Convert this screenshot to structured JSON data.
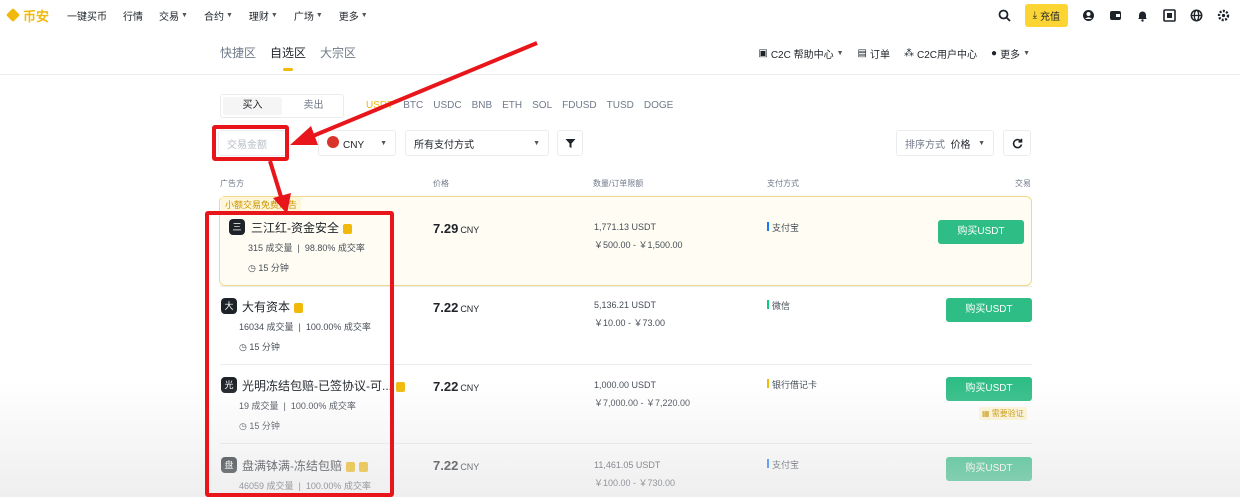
{
  "topbar": {
    "logo": "币安",
    "nav": [
      "一键买币",
      "行情",
      "交易",
      "合约",
      "理财",
      "广场",
      "更多"
    ],
    "nav_has_caret": [
      false,
      false,
      true,
      true,
      true,
      true,
      true
    ],
    "deposit": "充值"
  },
  "subnav": {
    "tabs": [
      "快捷区",
      "自选区",
      "大宗区"
    ],
    "active": "自选区"
  },
  "subnav_right": [
    "C2C 帮助中心",
    "订单",
    "C2C用户中心",
    "更多"
  ],
  "trade_toggle": {
    "buy": "买入",
    "sell": "卖出"
  },
  "coins": [
    "USDT",
    "BTC",
    "USDC",
    "BNB",
    "ETH",
    "SOL",
    "FDUSD",
    "TUSD",
    "DOGE"
  ],
  "coins_selected": "USDT",
  "filters": {
    "amount_placeholder": "交易金额",
    "currency": "CNY",
    "payment": "所有支付方式",
    "sort_label": "排序方式",
    "sort_value": "价格"
  },
  "table_headers": [
    "广告方",
    "价格",
    "数量/订单限额",
    "支付方式",
    "交易"
  ],
  "promo_tag": "小额交易免费广告",
  "listings": [
    {
      "avatar": "三",
      "merchant": "三江红-资金安全",
      "orders": "315 成交量",
      "completion": "98.80% 成交率",
      "time": "15 分钟",
      "price": "7.29",
      "currency": "CNY",
      "available": "1,771.13 USDT",
      "limit": "￥500.00 - ￥1,500.00",
      "payment": "支付宝",
      "button": "购买USDT"
    },
    {
      "avatar": "大",
      "merchant": "大有资本",
      "orders": "16034 成交量",
      "completion": "100.00% 成交率",
      "time": "15 分钟",
      "price": "7.22",
      "currency": "CNY",
      "available": "5,136.21 USDT",
      "limit": "￥10.00 - ￥73.00",
      "payment": "微信",
      "button": "购买USDT"
    },
    {
      "avatar": "光",
      "merchant": "光明冻结包赔-已签协议-可...",
      "orders": "19 成交量",
      "completion": "100.00% 成交率",
      "time": "15 分钟",
      "price": "7.22",
      "currency": "CNY",
      "available": "1,000.00 USDT",
      "limit": "￥7,000.00 - ￥7,220.00",
      "payment": "银行借记卡",
      "button": "购买USDT",
      "verify": "需要验证"
    },
    {
      "avatar": "盘",
      "merchant": "盘满钵满-冻结包赔",
      "orders": "46059 成交量",
      "completion": "100.00% 成交率",
      "time": "",
      "price": "7.22",
      "currency": "CNY",
      "available": "11,461.05 USDT",
      "limit": "￥100.00 - ￥730.00",
      "payment": "支付宝",
      "button": "购买USDT"
    }
  ],
  "colors": {
    "brand": "#f0b90b",
    "buy_green": "#2ebd85",
    "annotation_red": "#e8161b"
  }
}
